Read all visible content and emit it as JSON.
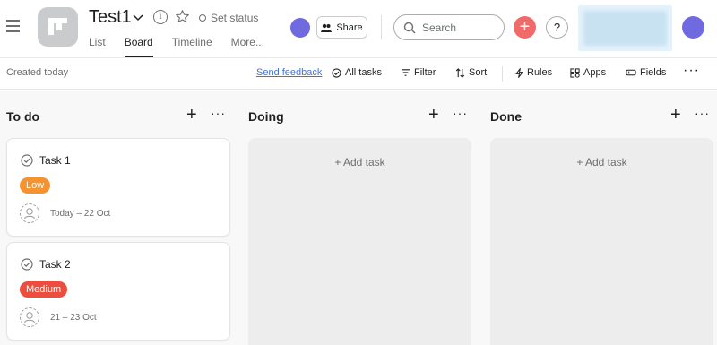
{
  "header": {
    "project_title": "Test1",
    "set_status_label": "Set status",
    "tabs": [
      {
        "label": "List",
        "active": false
      },
      {
        "label": "Board",
        "active": true
      },
      {
        "label": "Timeline",
        "active": false
      },
      {
        "label": "More...",
        "active": false
      }
    ],
    "share_label": "Share",
    "search_placeholder": "Search",
    "help_label": "?",
    "avatar_color": "#6f6ae0",
    "accent_plus_color": "#f06a6a"
  },
  "toolbar": {
    "created": "Created today",
    "send_feedback": "Send feedback",
    "all_tasks": "All tasks",
    "filter": "Filter",
    "sort": "Sort",
    "rules": "Rules",
    "apps": "Apps",
    "fields": "Fields",
    "more": "···"
  },
  "board": {
    "columns": [
      {
        "title": "To do",
        "tasks": [
          {
            "name": "Task 1",
            "priority": "Low",
            "priority_color": "#f59331",
            "date": "Today – 22 Oct"
          },
          {
            "name": "Task 2",
            "priority": "Medium",
            "priority_color": "#ec4d3d",
            "date": "21 – 23 Oct"
          }
        ]
      },
      {
        "title": "Doing",
        "add_task": "+ Add task"
      },
      {
        "title": "Done",
        "add_task": "+ Add task"
      }
    ]
  }
}
